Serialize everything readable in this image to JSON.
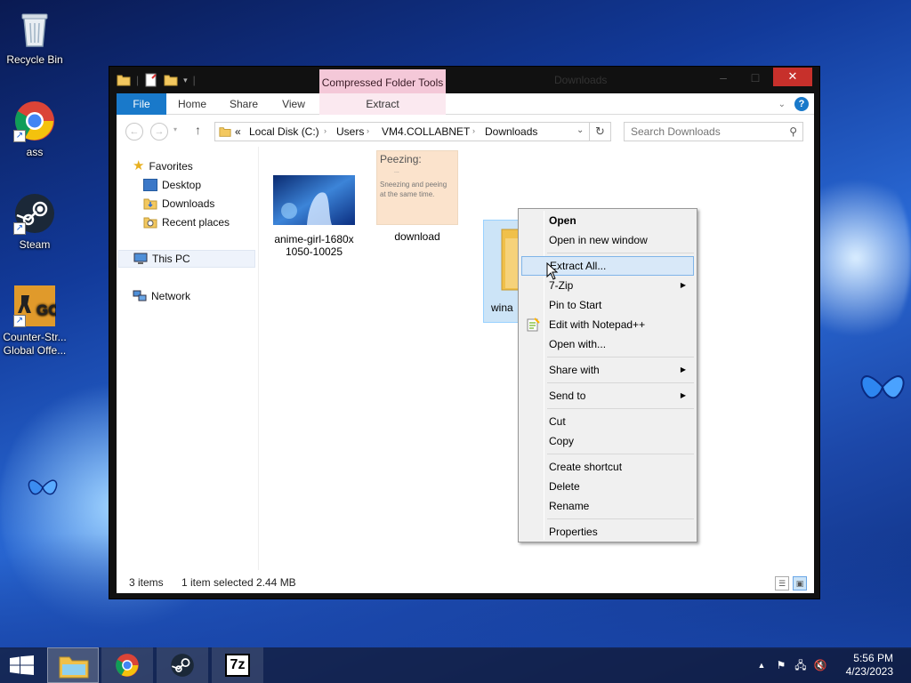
{
  "desktop": {
    "icons": [
      {
        "label": "Recycle Bin",
        "icon": "recycle-bin-icon"
      },
      {
        "label": "ass",
        "icon": "chrome-icon"
      },
      {
        "label": "Steam",
        "icon": "steam-icon"
      },
      {
        "label": "Counter-Str... Global Offe...",
        "icon": "csgo-icon"
      }
    ]
  },
  "window": {
    "title": "Downloads",
    "contextual_tab_group": "Compressed Folder Tools",
    "tabs": [
      "File",
      "Home",
      "Share",
      "View",
      "Extract"
    ],
    "address": {
      "prefix": "«",
      "segments": [
        "Local Disk (C:)",
        "Users",
        "VM4.COLLABNET",
        "Downloads"
      ]
    },
    "search": {
      "placeholder": "Search Downloads"
    },
    "nav": {
      "favorites": "Favorites",
      "favorites_items": [
        "Desktop",
        "Downloads",
        "Recent places"
      ],
      "this_pc": "This PC",
      "network": "Network"
    },
    "files": [
      {
        "name": "anime-girl-1680x1050-10025",
        "line1": "anime-girl-1680x",
        "line2": "1050-10025",
        "type": "image"
      },
      {
        "name": "download",
        "type": "image",
        "thumb_title": "Peezing:",
        "thumb_subtitle": "...",
        "thumb_text": "Sneezing and peeing at the same time."
      },
      {
        "name": "wina",
        "type": "zip",
        "selected": true
      }
    ],
    "status": {
      "items": "3 items",
      "selection": "1 item selected",
      "size": "2.44 MB"
    }
  },
  "context_menu": {
    "items": [
      "Open",
      "Open in new window",
      "Extract All...",
      "7-Zip",
      "Pin to Start",
      "Edit with Notepad++",
      "Open with...",
      "Share with",
      "Send to",
      "Cut",
      "Copy",
      "Create shortcut",
      "Delete",
      "Rename",
      "Properties"
    ],
    "hovered": "Extract All..."
  },
  "taskbar": {
    "apps": [
      "start",
      "file-explorer",
      "chrome",
      "steam",
      "7-zip"
    ],
    "tray_7zip_label": "7z",
    "time": "5:56 PM",
    "date": "4/23/2023"
  },
  "colors": {
    "accent": "#1979ca",
    "contextual_tab": "#f4c8d8",
    "close": "#c7302b",
    "selection": "#cce4f7"
  }
}
